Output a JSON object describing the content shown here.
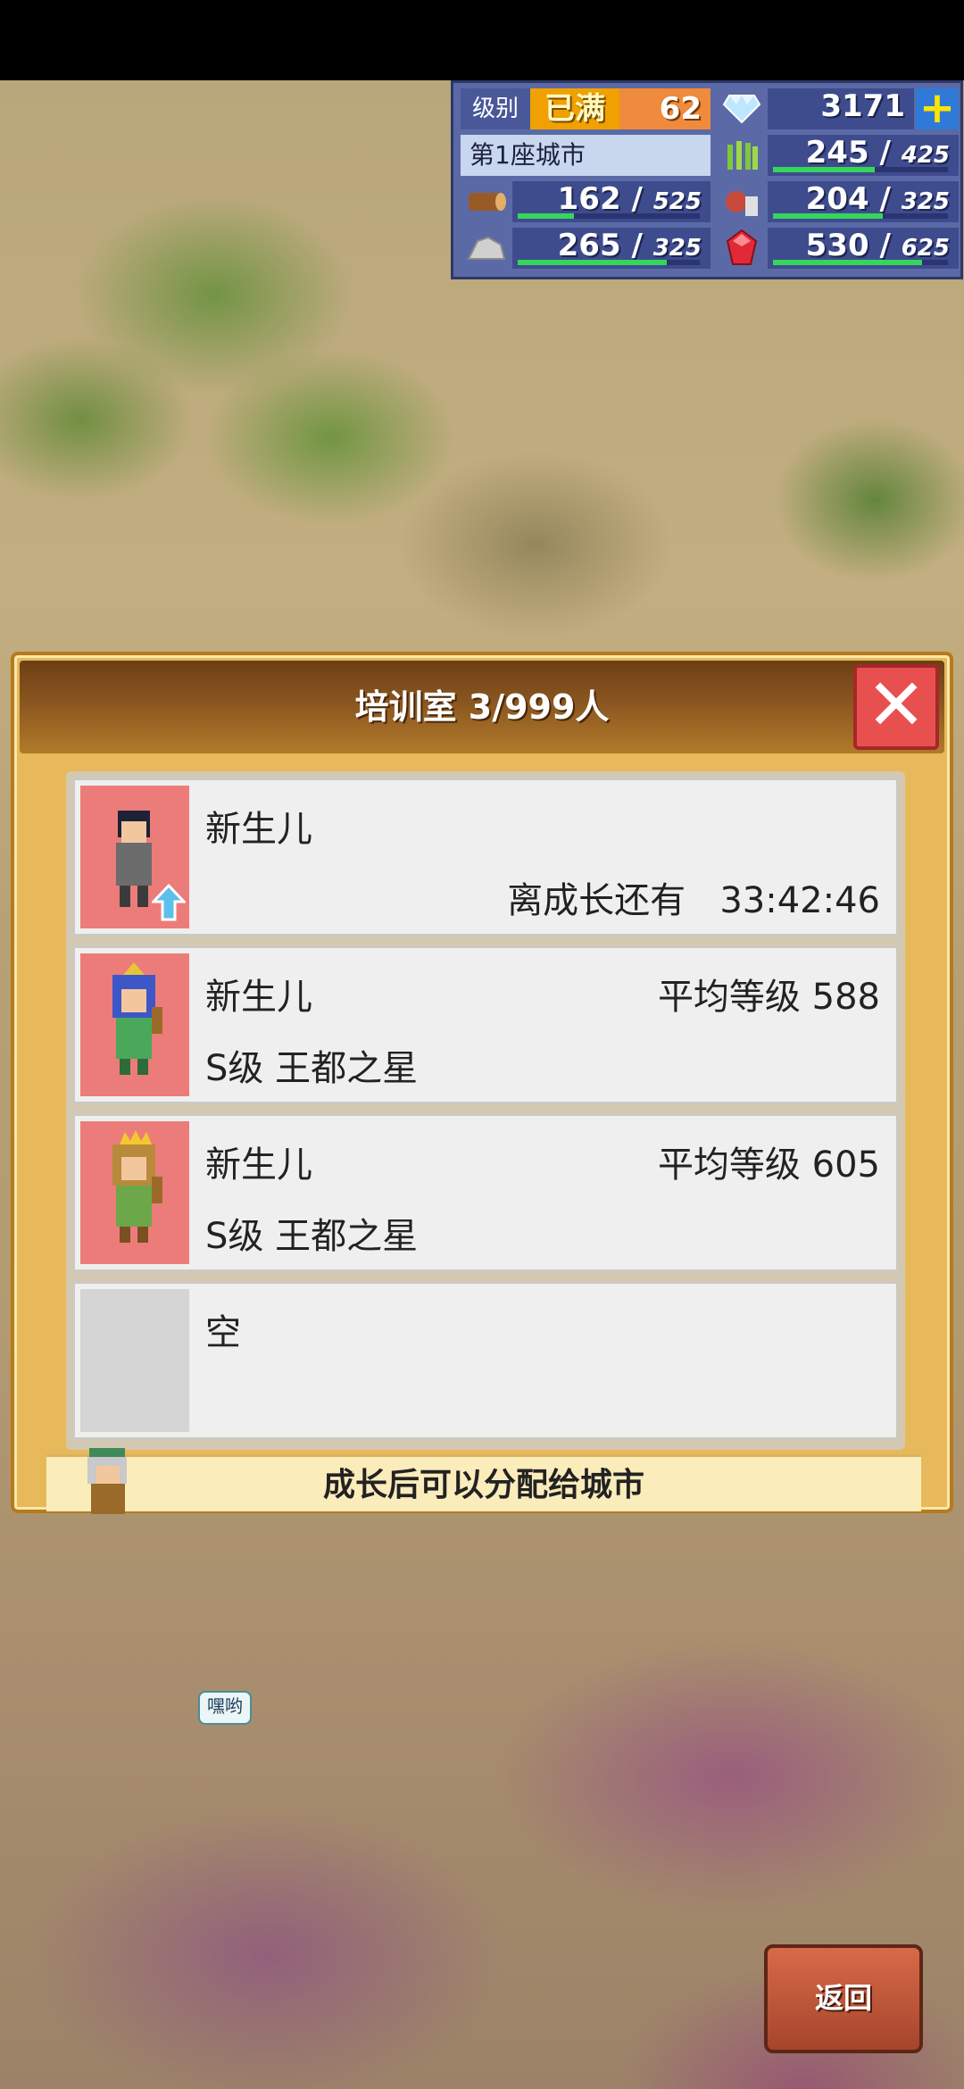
{
  "resources": {
    "level_label": "级别",
    "level_max": "已满",
    "level_value": "62",
    "gems": "3171",
    "city_name": "第1座城市",
    "food": {
      "value": "245",
      "max": "425",
      "fill": 0.58
    },
    "wood": {
      "value": "162",
      "max": "525",
      "fill": 0.31
    },
    "meat": {
      "value": "204",
      "max": "325",
      "fill": 0.63
    },
    "stone": {
      "value": "265",
      "max": "325",
      "fill": 0.82
    },
    "ruby": {
      "value": "530",
      "max": "625",
      "fill": 0.85
    }
  },
  "dialog": {
    "title": "培训室 3/999人",
    "rows": [
      {
        "name": "新生儿",
        "sub_label": "离成长还有",
        "time": "33:42:46"
      },
      {
        "name": "新生儿",
        "avg_label": "平均等级 588",
        "rank": "S级 王都之星"
      },
      {
        "name": "新生儿",
        "avg_label": "平均等级 605",
        "rank": "S级 王都之星"
      },
      {
        "name": "空"
      }
    ],
    "hint": "成长后可以分配给城市"
  },
  "speech_bubble": "嘿哟",
  "back_button": "返回"
}
